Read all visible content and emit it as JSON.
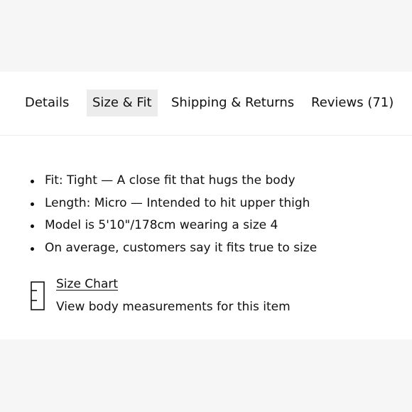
{
  "tabs": [
    {
      "label": "Details",
      "active": false
    },
    {
      "label": "Size & Fit",
      "active": true
    },
    {
      "label": "Shipping & Returns",
      "active": false
    },
    {
      "label": "Reviews (71)",
      "active": false
    }
  ],
  "fit_details": [
    "Fit: Tight — A close fit that hugs the body",
    "Length: Micro — Intended to hit upper thigh",
    "Model is 5'10\"/178cm wearing a size 4",
    "On average, customers say it fits true to size"
  ],
  "size_chart": {
    "icon": "ruler-icon",
    "link_label": "Size Chart",
    "description": "View body measurements for this item"
  },
  "colors": {
    "page_background": "#f6f6f6",
    "panel_background": "#ffffff",
    "active_tab_background": "#ececec",
    "text": "#111111"
  }
}
